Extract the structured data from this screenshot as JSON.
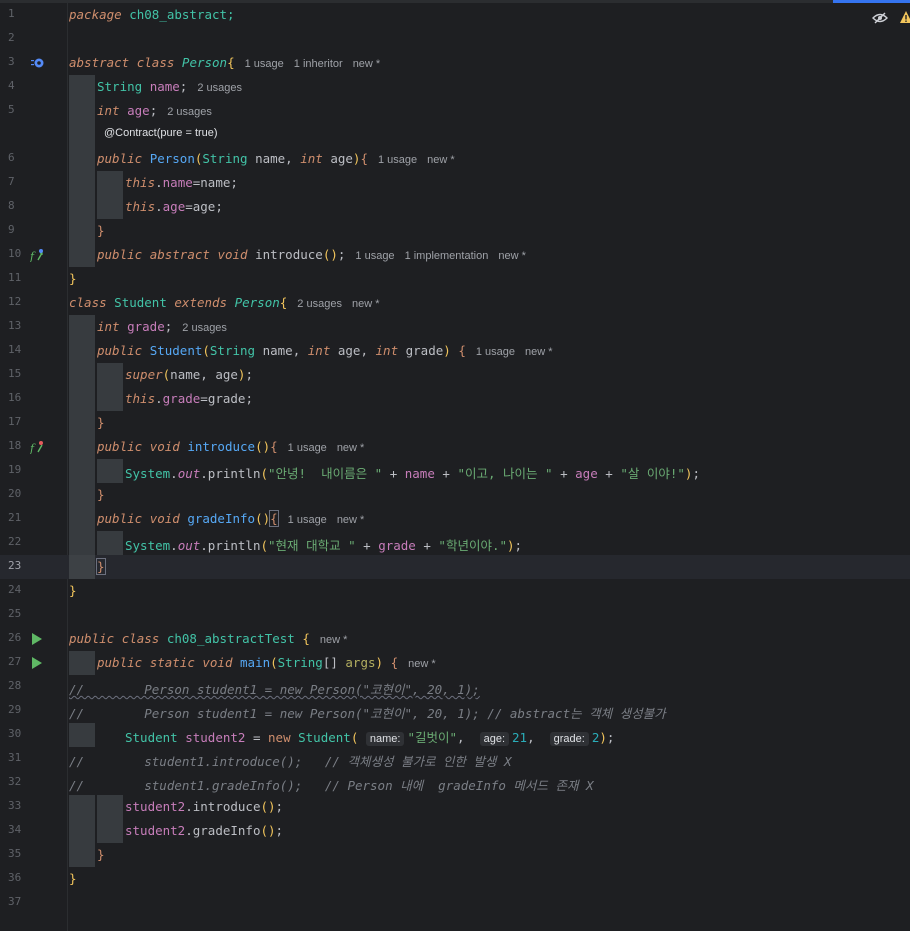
{
  "editor": {
    "line_numbers": [
      "1",
      "2",
      "3",
      "4",
      "5",
      "",
      "6",
      "7",
      "8",
      "9",
      "10",
      "11",
      "12",
      "13",
      "14",
      "15",
      "16",
      "17",
      "18",
      "19",
      "20",
      "21",
      "22",
      "23",
      "24",
      "25",
      "26",
      "27",
      "28",
      "29",
      "30",
      "31",
      "32",
      "33",
      "34",
      "35",
      "36",
      "37"
    ],
    "tokens": {
      "package_kw": "package",
      "package_name": "ch08_abstract;",
      "abstract_kw": "abstract",
      "class_kw": "class",
      "person_cls": "Person",
      "string_type": "String",
      "int_kw": "int",
      "name_fld": "name",
      "age_fld": "age",
      "public_kw": "public",
      "this_kw": "this",
      "void_kw": "void",
      "introduce_fn": "introduce",
      "student_cls": "Student",
      "extends_kw": "extends",
      "grade_fld": "grade",
      "super_kw": "super",
      "system": "System",
      "out": "out",
      "println": "println",
      "gradeinfo_fn": "gradeInfo",
      "static_kw": "static",
      "main_fn": "main",
      "args_param": "args",
      "test_cls": "ch08_abstractTest",
      "student2_var": "student2",
      "new_kw": "new"
    },
    "strings": {
      "hello": "\"안녕!  내이름은 \"",
      "and_age": "\"이고, 나이는 \"",
      "years": "\"살 이야!\"",
      "current": "\"현재 대학교 \"",
      "grade_suffix": "\"학년이야.\"",
      "gilbeot": "\"길벗이\""
    },
    "numbers": {
      "age": "21",
      "grade": "2"
    },
    "comments": {
      "l28": "//        Person student1 = new Person(\"코현이\", 20, 1);",
      "l29": "//        Person student1 = new Person(\"코현이\", 20, 1); // abstract는 객체 생성불가",
      "l31": "//        student1.introduce();   // 객체생성 불가로 인한 발생 X",
      "l32": "//        student1.gradeInfo();   // Person 내에  gradeInfo 메서드 존재 X"
    },
    "annotation": "@Contract(pure = true)",
    "hints": {
      "name": "name:",
      "age": "age:",
      "grade": "grade:"
    },
    "lens": {
      "l3": [
        "1 usage",
        "1 inheritor",
        "new *"
      ],
      "l4": [
        "2 usages"
      ],
      "l5": [
        "2 usages"
      ],
      "l6": [
        "1 usage",
        "new *"
      ],
      "l10": [
        "1 usage",
        "1 implementation",
        "new *"
      ],
      "l12": [
        "2 usages",
        "new *"
      ],
      "l13": [
        "2 usages"
      ],
      "l14": [
        "1 usage",
        "new *"
      ],
      "l18": [
        "1 usage",
        "new *"
      ],
      "l21": [
        "1 usage",
        "new *"
      ],
      "l26": [
        "new *"
      ],
      "l27": [
        "new *"
      ]
    },
    "current_line": "23"
  },
  "colors": {
    "background": "#1e1f22",
    "keyword": "#cf8e6d",
    "string": "#6aab73",
    "field": "#c77dba",
    "class": "#42c3a7",
    "comment": "#7a7e85",
    "number": "#2aacb8",
    "run": "#5fb865"
  }
}
